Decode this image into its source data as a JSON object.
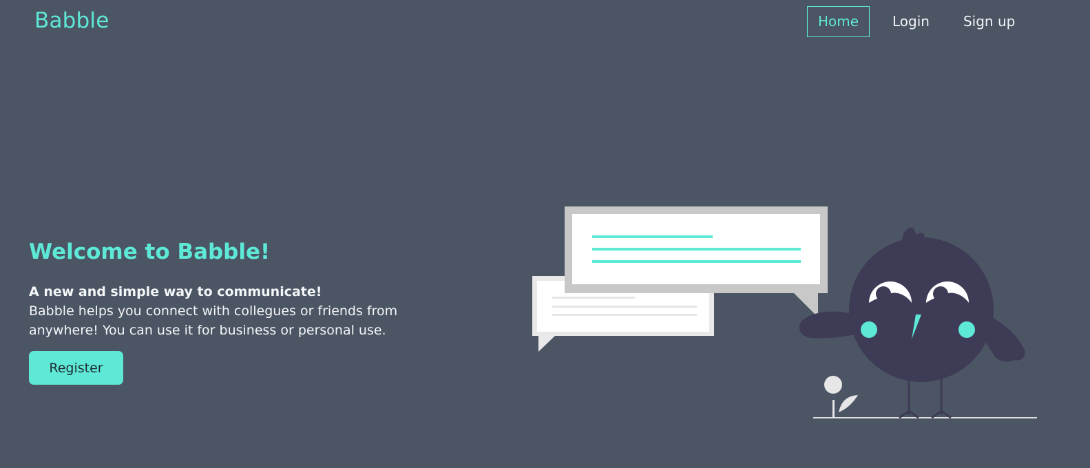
{
  "brand": {
    "name": "Babble"
  },
  "nav": {
    "home_label": "Home",
    "login_label": "Login",
    "signup_label": "Sign up",
    "active_item": "home"
  },
  "hero": {
    "title": "Welcome to Babble!",
    "tagline": "A new and simple way to communicate!",
    "description": "Babble helps you connect with collegues or friends from anywhere! You can use it for business or personal use.",
    "register_label": "Register"
  },
  "illustration": {
    "name": "bird-with-chat-bubbles-illustration"
  },
  "colors": {
    "background": "#4b5564",
    "accent": "#5ee8d6",
    "text": "#f4f6f8",
    "bird": "#3d3b55"
  }
}
